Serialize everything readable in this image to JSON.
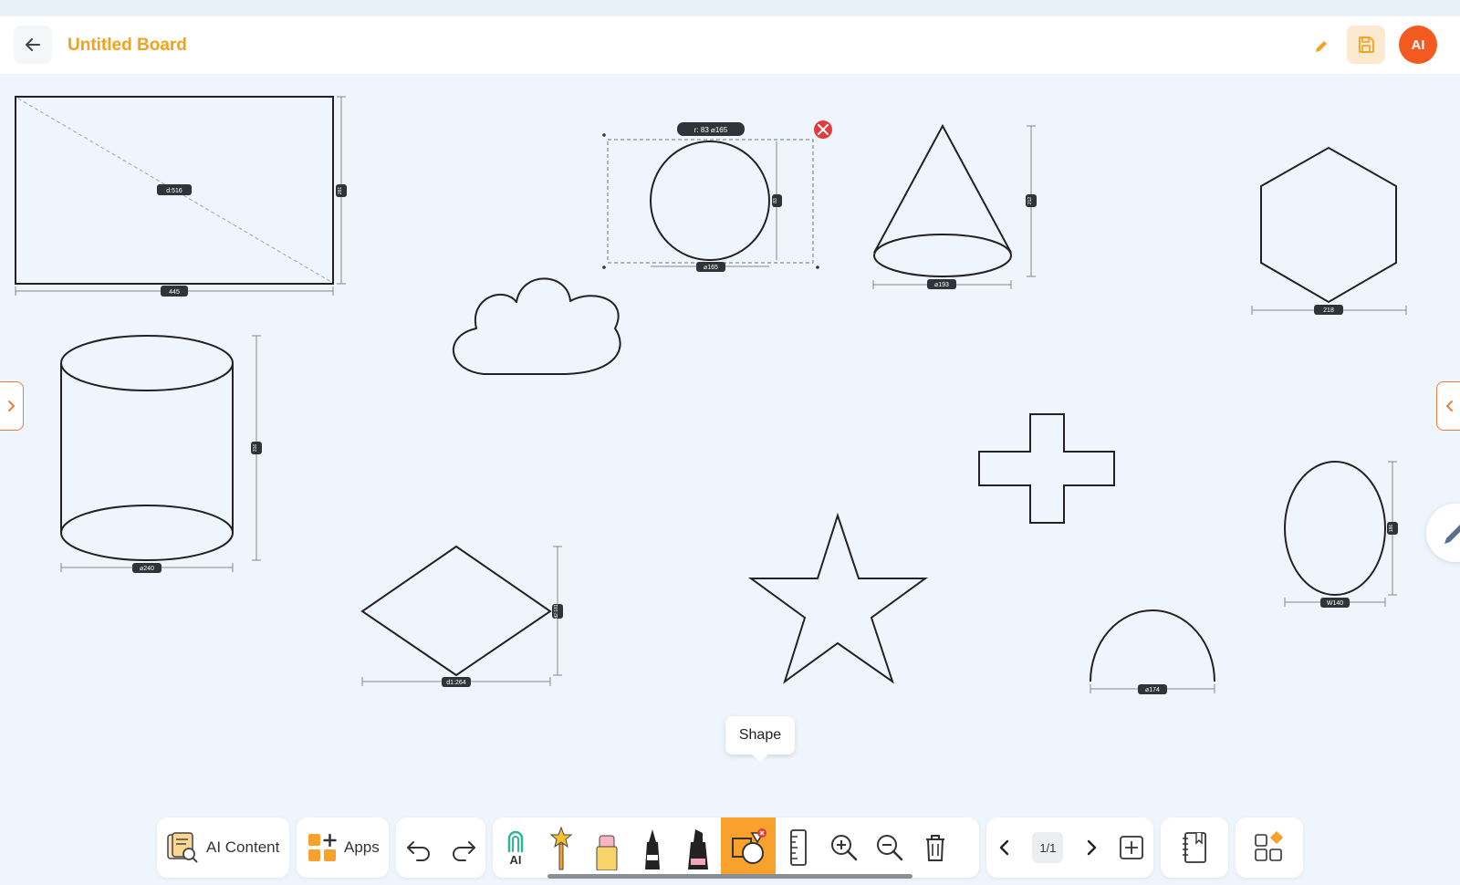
{
  "header": {
    "title": "Untitled Board",
    "avatar_initials": "AI"
  },
  "canvas": {
    "shapes": [
      {
        "name": "rectangle",
        "labels": {
          "diagonal": "d:516",
          "width": "445",
          "height": "281"
        }
      },
      {
        "name": "circle",
        "labels": {
          "top": "r: 83  ⌀165",
          "bottom": "⌀165",
          "side": "83"
        }
      },
      {
        "name": "cone",
        "labels": {
          "bottom": "⌀193",
          "side": "212"
        }
      },
      {
        "name": "hexagon",
        "labels": {
          "bottom": "218"
        }
      },
      {
        "name": "cloud",
        "labels": {}
      },
      {
        "name": "cylinder",
        "labels": {
          "bottom": "⌀240",
          "side": "316"
        }
      },
      {
        "name": "cross",
        "labels": {}
      },
      {
        "name": "ellipse",
        "labels": {
          "bottom": "W140",
          "side": "186"
        }
      },
      {
        "name": "diamond",
        "labels": {
          "bottom": "d1:264",
          "side": "d2:181"
        }
      },
      {
        "name": "star",
        "labels": {}
      },
      {
        "name": "semicircle",
        "labels": {
          "bottom": "⌀174"
        }
      }
    ],
    "tooltip": "Shape"
  },
  "toolbar": {
    "ai_content_label": "AI Content",
    "apps_label": "Apps",
    "ai_tool_label": "AI",
    "page_indicator": "1/1",
    "active_tool": "shape"
  },
  "colors": {
    "accent": "#f4a11c",
    "avatar": "#f35a1f",
    "active_tool": "#f8a12c",
    "close": "#e23b3b"
  }
}
